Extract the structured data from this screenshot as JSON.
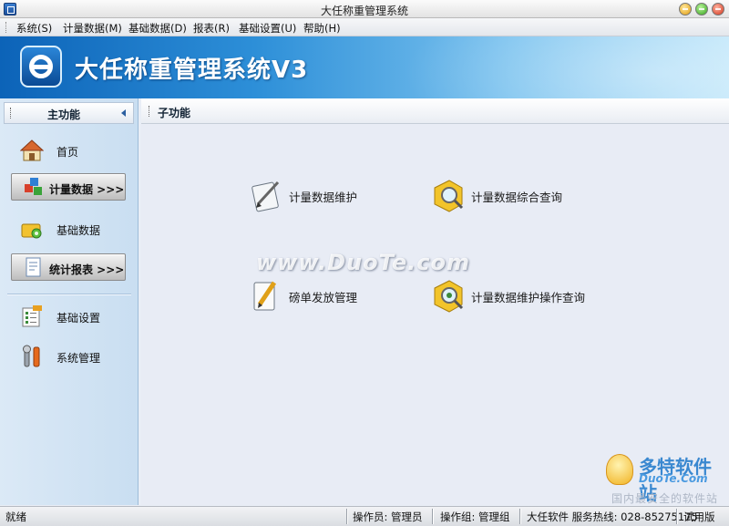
{
  "window": {
    "title": "大任称重管理系统"
  },
  "menu": [
    {
      "label": "系统(S)"
    },
    {
      "label": "计量数据(M)"
    },
    {
      "label": "基础数据(D)"
    },
    {
      "label": "报表(R)"
    },
    {
      "label": "基础设置(U)"
    },
    {
      "label": "帮助(H)"
    }
  ],
  "banner": {
    "title": "大任称重管理系统V3"
  },
  "left_panel": {
    "title": "主功能",
    "items": [
      {
        "label": "首页",
        "icon": "home-icon"
      },
      {
        "label": "计量数据 >>>",
        "icon": "cubes-icon"
      },
      {
        "label": "基础数据",
        "icon": "folder-gear-icon"
      },
      {
        "label": "统计报表 >>>",
        "icon": "report-icon"
      },
      {
        "label": "基础设置",
        "icon": "settings-sheet-icon"
      },
      {
        "label": "系统管理",
        "icon": "tools-icon"
      }
    ]
  },
  "right_panel": {
    "title": "子功能",
    "functions": [
      {
        "label": "计量数据维护",
        "icon": "edit-icon"
      },
      {
        "label": "计量数据综合查询",
        "icon": "search-box-icon"
      },
      {
        "label": "磅单发放管理",
        "icon": "pencil-paper-icon"
      },
      {
        "label": "计量数据维护操作查询",
        "icon": "search-gear-icon"
      }
    ]
  },
  "watermarks": {
    "center": "www.DuoTe.com",
    "corner_main": "多特软件站",
    "corner_sub": "DuoTe.Com",
    "corner_foot": "国内最安全的软件站"
  },
  "status": {
    "state": "就绪",
    "operator": "操作员: 管理员",
    "group": "操作组: 管理组",
    "company": "大任软件 服务热线: 028-85275175",
    "edition": "试用版"
  }
}
